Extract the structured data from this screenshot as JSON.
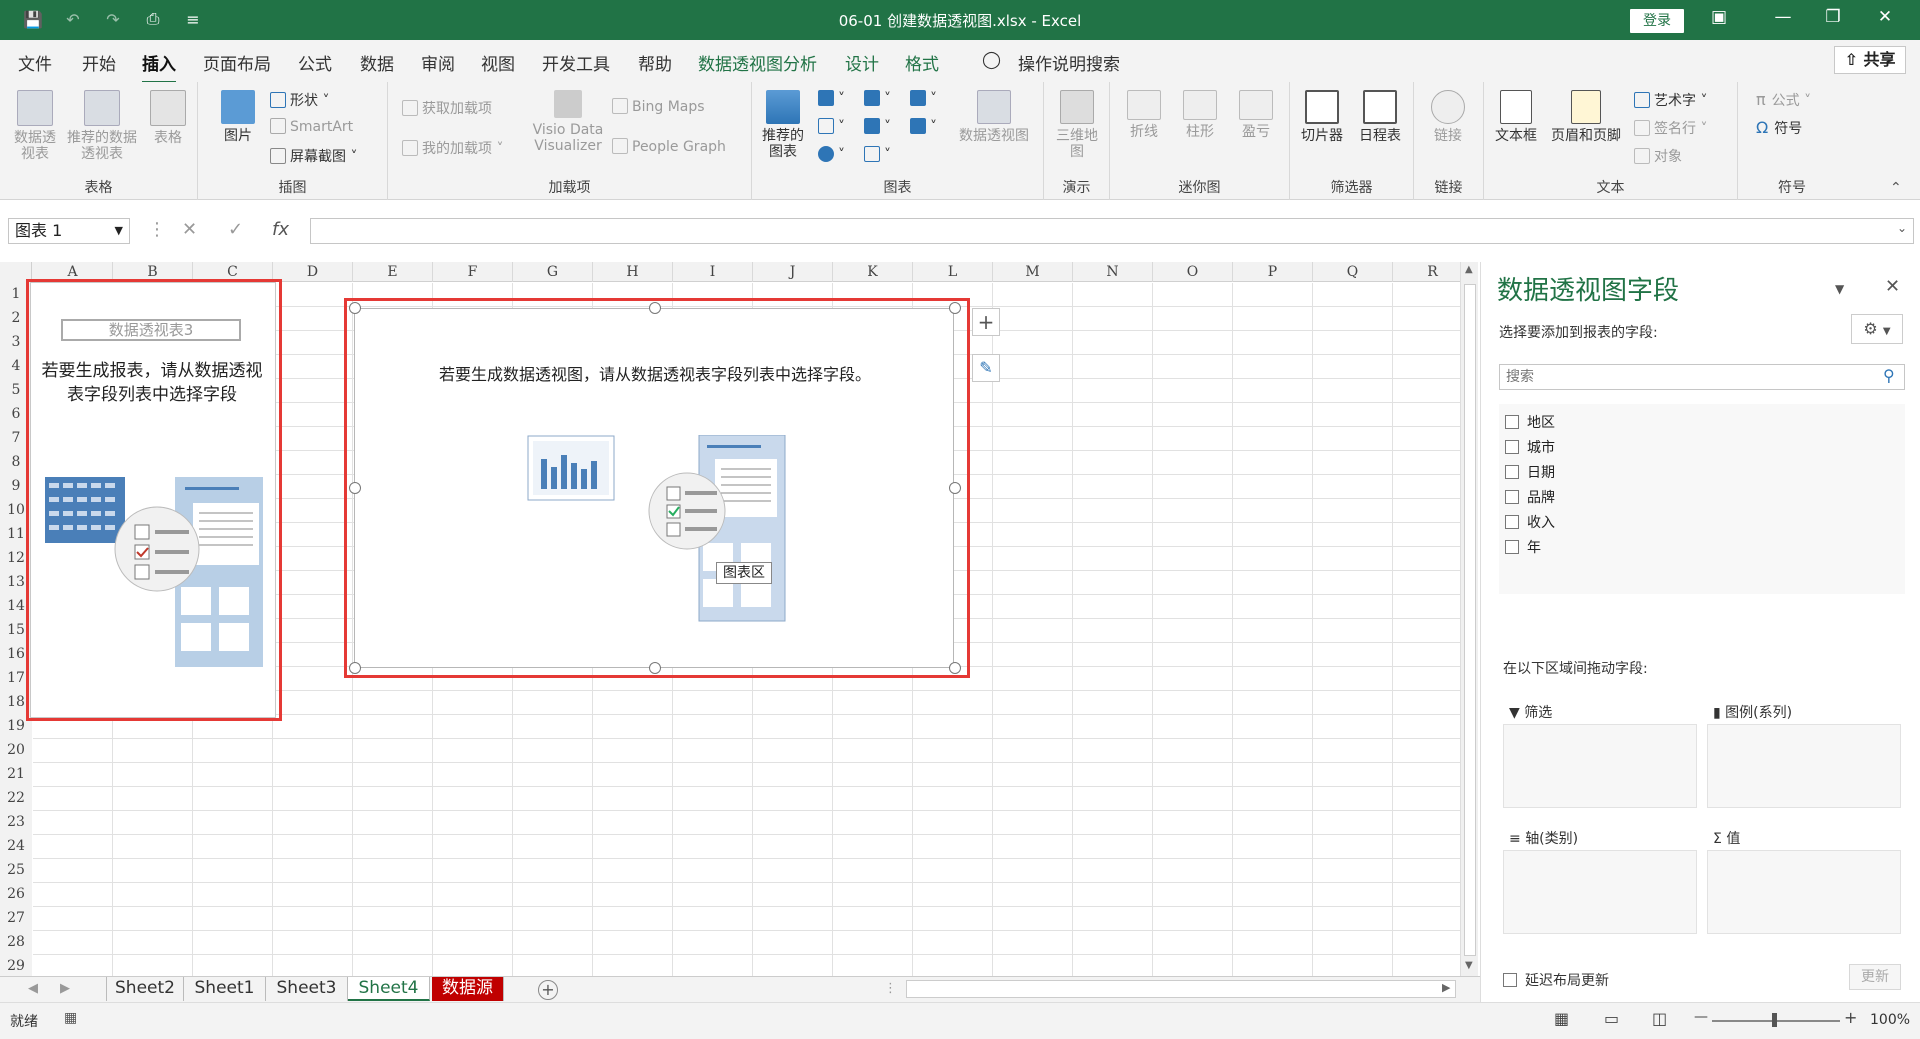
{
  "window": {
    "title": "06-01 创建数据透视图.xlsx  -  Excel",
    "login": "登录"
  },
  "menu": {
    "tabs": [
      "文件",
      "开始",
      "插入",
      "页面布局",
      "公式",
      "数据",
      "审阅",
      "视图",
      "开发工具",
      "帮助",
      "数据透视图分析",
      "设计",
      "格式"
    ],
    "active": "插入",
    "search": "操作说明搜索",
    "share": "共享"
  },
  "ribbon": {
    "groups": {
      "tables": {
        "label": "表格",
        "pivot": "数据透视表",
        "recommended_pivot": "推荐的数据透视表",
        "table": "表格"
      },
      "illustrations": {
        "label": "插图",
        "picture": "图片",
        "shapes": "形状",
        "smartart": "SmartArt",
        "screenshot": "屏幕截图"
      },
      "addins": {
        "label": "加载项",
        "get_addins": "获取加载项",
        "my_addins": "我的加载项",
        "visio": "Visio Data Visualizer",
        "bing_maps": "Bing Maps",
        "people_graph": "People Graph"
      },
      "charts": {
        "label": "图表",
        "recommended": "推荐的图表",
        "pivot_chart": "数据透视图"
      },
      "tours": {
        "label": "演示",
        "map3d": "三维地图"
      },
      "sparklines": {
        "label": "迷你图",
        "line": "折线",
        "column": "柱形",
        "winloss": "盈亏"
      },
      "filters": {
        "label": "筛选器",
        "slicer": "切片器",
        "timeline": "日程表"
      },
      "links": {
        "label": "链接",
        "link": "链接"
      },
      "text": {
        "label": "文本",
        "textbox": "文本框",
        "header_footer": "页眉和页脚",
        "wordart": "艺术字",
        "signature": "签名行",
        "object": "对象"
      },
      "symbols": {
        "label": "符号",
        "equation": "公式",
        "symbol": "符号"
      }
    }
  },
  "formula_bar": {
    "name_box": "图表 1",
    "fx": "fx"
  },
  "grid": {
    "columns": [
      "A",
      "B",
      "C",
      "D",
      "E",
      "F",
      "G",
      "H",
      "I",
      "J",
      "K",
      "L",
      "M",
      "N",
      "O",
      "P",
      "Q",
      "R"
    ],
    "rows": [
      "1",
      "2",
      "3",
      "4",
      "5",
      "6",
      "7",
      "8",
      "9",
      "10",
      "11",
      "12",
      "13",
      "14",
      "15",
      "16",
      "17",
      "18",
      "19",
      "20",
      "21",
      "22",
      "23",
      "24",
      "25",
      "26",
      "27",
      "28",
      "29"
    ]
  },
  "pivot_placeholder": {
    "title": "数据透视表3",
    "text": "若要生成报表，请从数据透视表字段列表中选择字段"
  },
  "chart_placeholder": {
    "text": "若要生成数据透视图，请从数据透视表字段列表中选择字段。",
    "tooltip": "图表区"
  },
  "sheets": {
    "tabs": [
      "Sheet2",
      "Sheet1",
      "Sheet3",
      "Sheet4",
      "数据源"
    ],
    "active": "Sheet4"
  },
  "status": {
    "ready": "就绪",
    "zoom": "100%"
  },
  "pane": {
    "title": "数据透视图字段",
    "subtitle": "选择要添加到报表的字段:",
    "search_placeholder": "搜索",
    "fields": [
      "地区",
      "城市",
      "日期",
      "品牌",
      "收入",
      "年"
    ],
    "areas_label": "在以下区域间拖动字段:",
    "areas": {
      "filter": "筛选",
      "legend": "图例(系列)",
      "axis": "轴(类别)",
      "values": "值"
    },
    "defer": "延迟布局更新",
    "update": "更新"
  },
  "colors": {
    "brand": "#217346",
    "highlight": "#e53935",
    "data_source_tab": "#c00000"
  }
}
